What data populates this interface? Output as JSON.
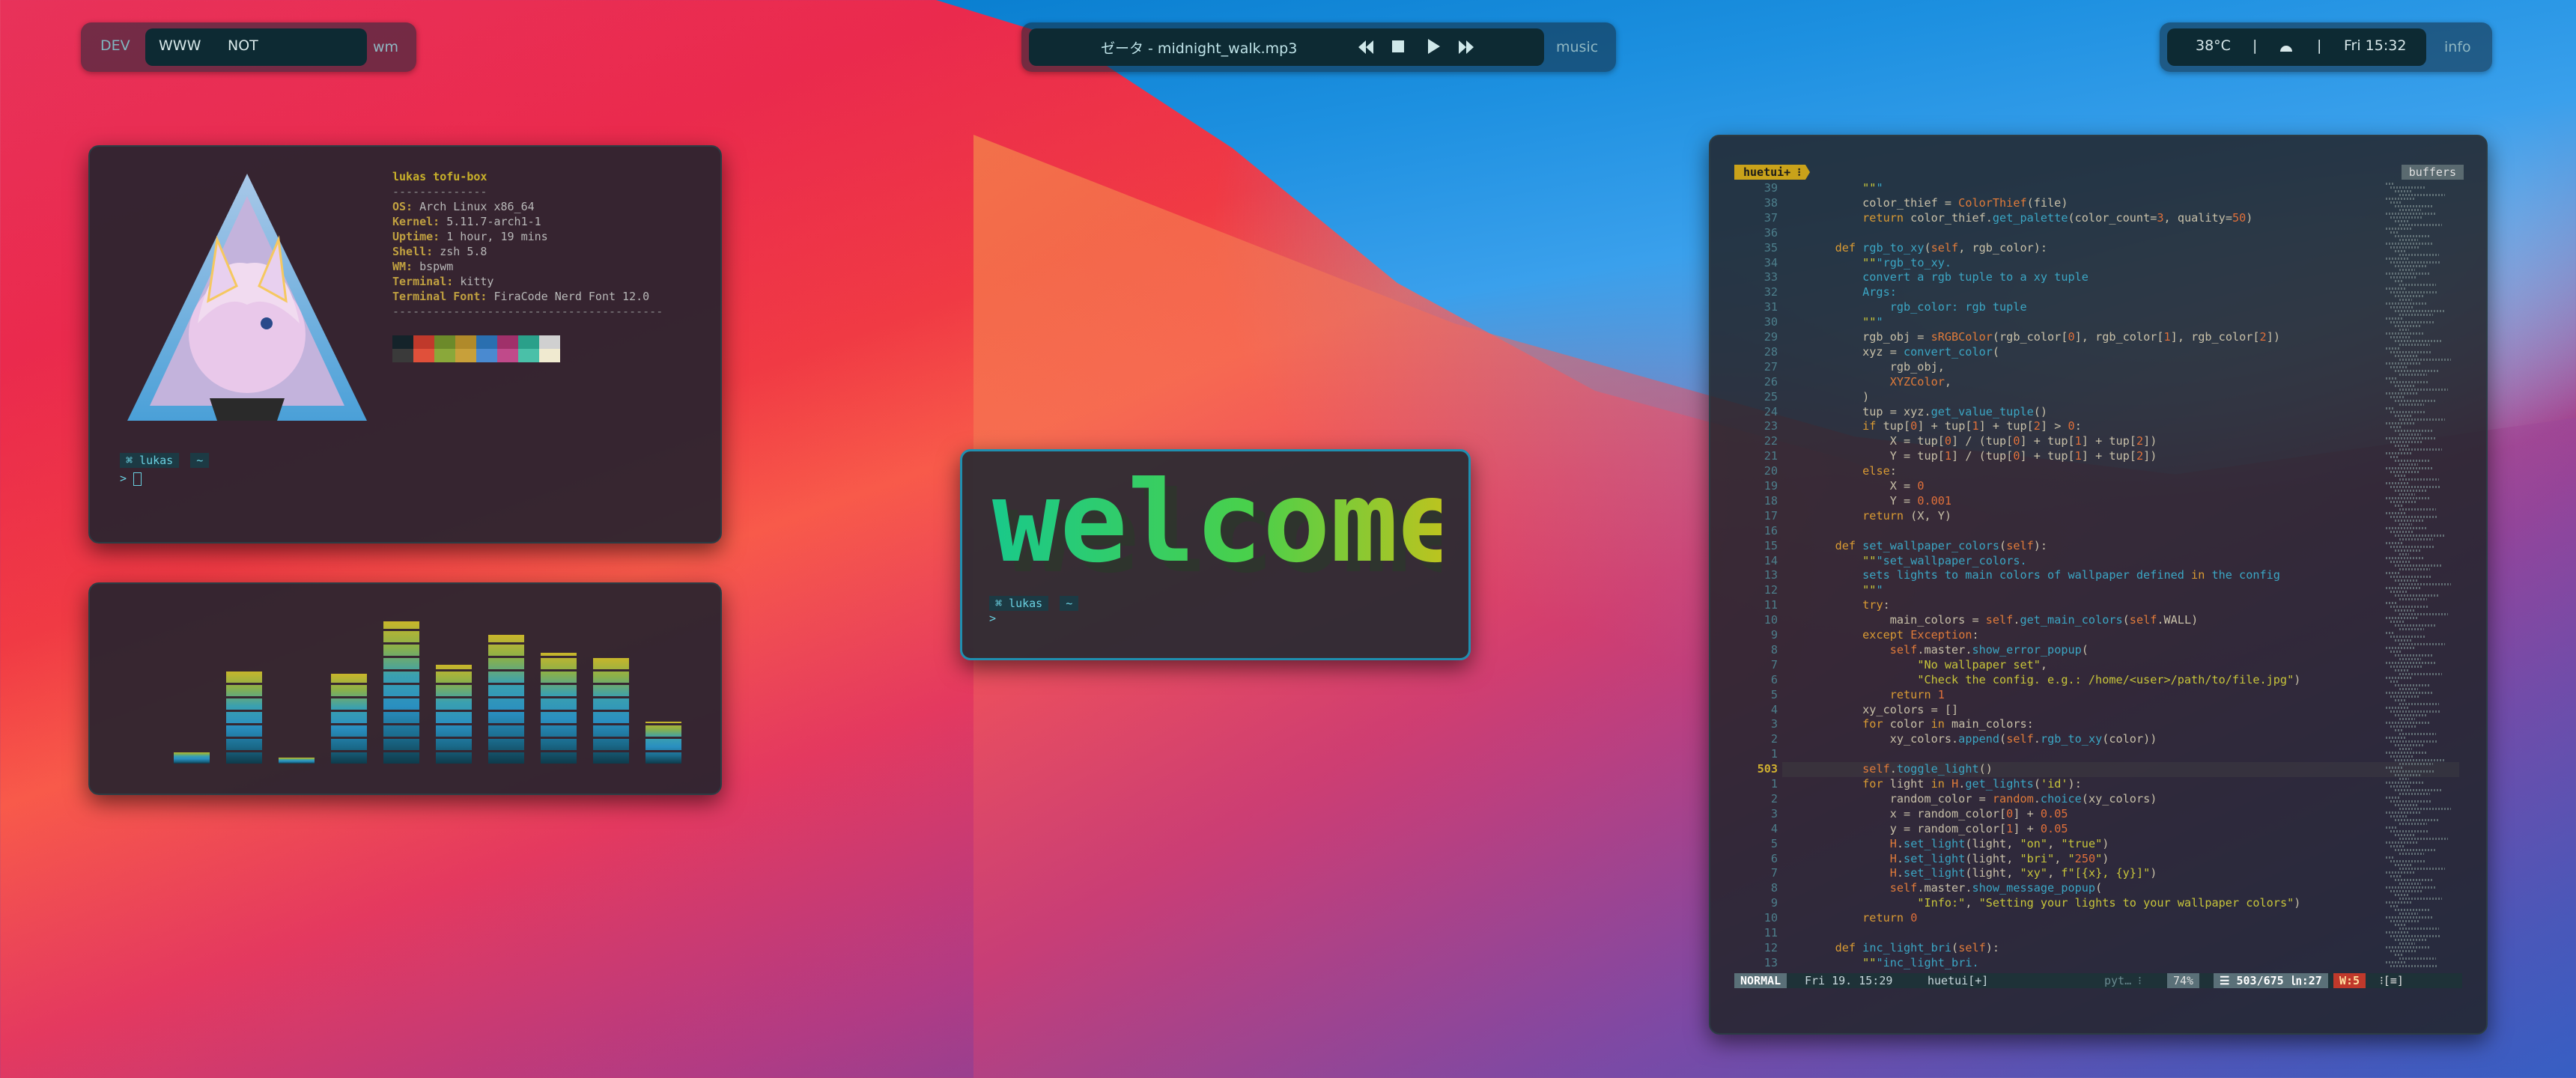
{
  "colors": {
    "accent": "#1f8fb0",
    "yellow": "#c0a040",
    "green": "#21c58a"
  },
  "topbar": {
    "left": {
      "workspaces": [
        "DEV",
        "WWW",
        "NOT"
      ],
      "tag": "wm"
    },
    "center": {
      "track": "ゼータ - midnight_walk.mp3",
      "tag": "music",
      "controls": [
        "prev-icon",
        "stop-icon",
        "play-icon",
        "next-icon"
      ]
    },
    "right": {
      "temp": "38°C",
      "sep": "|",
      "weather_icon": "cloud-icon",
      "time": "Fri 15:32",
      "tag": "info"
    }
  },
  "neofetch": {
    "title": "lukas tofu-box",
    "rule": "--------------",
    "rows": [
      {
        "key": "OS:",
        "val": "Arch Linux x86_64"
      },
      {
        "key": "Kernel:",
        "val": "5.11.7-arch1-1"
      },
      {
        "key": "Uptime:",
        "val": "1 hour, 19 mins"
      },
      {
        "key": "Shell:",
        "val": "zsh 5.8"
      },
      {
        "key": "WM:",
        "val": "bspwm"
      },
      {
        "key": "Terminal:",
        "val": "kitty"
      },
      {
        "key": "Terminal Font:",
        "val": "FiraCode Nerd Font 12.0"
      }
    ],
    "rule2": "----------------------------------------",
    "palette_top": [
      "#14232a",
      "#c0392b",
      "#6c8a2a",
      "#b08a2a",
      "#2a6fb0",
      "#a0306a",
      "#2aa08a",
      "#d0d0d0"
    ],
    "palette_bot": [
      "#3a3a3a",
      "#e0503a",
      "#8aa83a",
      "#c8a03a",
      "#4a8ad0",
      "#c04a8a",
      "#4ac0a8",
      "#f0ead0"
    ],
    "prompt_user": "⌘ lukas",
    "prompt_dir": "~",
    "prompt_caret": ">"
  },
  "visualizer": {
    "levels": [
      0.08,
      0.62,
      0.04,
      0.6,
      0.95,
      0.66,
      0.86,
      0.74,
      0.71,
      0.28
    ]
  },
  "welcome": {
    "text": "welcome",
    "prompt_user": "⌘ lukas",
    "prompt_dir": "~",
    "prompt_caret": ">"
  },
  "editor": {
    "tab": "huetui+ ⁝",
    "buffers": "buffers",
    "status": {
      "mode": "NORMAL",
      "date": "Fri 19. 15:29",
      "file": "huetui[+]",
      "ft": "pyt… ⁝",
      "pct": "74%",
      "pos": "☰ 503/675 ㏑:27",
      "warn": "W:5",
      "extra": "⁝[≡]"
    },
    "current_line": "503",
    "line_numbers": [
      "39",
      "38",
      "37",
      "36",
      "35",
      "34",
      "33",
      "32",
      "31",
      "30",
      "29",
      "28",
      "27",
      "26",
      "25",
      "24",
      "23",
      "22",
      "21",
      "20",
      "19",
      "18",
      "17",
      "16",
      "15",
      "14",
      "13",
      "12",
      "11",
      "10",
      "9",
      "8",
      "7",
      "6",
      "5",
      "4",
      "3",
      "2",
      "1",
      "503",
      "1",
      "2",
      "3",
      "4",
      "5",
      "6",
      "7",
      "8",
      "9",
      "10",
      "11",
      "12",
      "13"
    ],
    "lines": [
      "        \"\"\"",
      "        color_thief = ColorThief(file)",
      "        return color_thief.get_palette(color_count=3, quality=50)",
      "",
      "    def rgb_to_xy(self, rgb_color):",
      "        \"\"\"rgb_to_xy.",
      "        convert a rgb tuple to a xy tuple",
      "        Args:",
      "            rgb_color: rgb tuple",
      "        \"\"\"",
      "        rgb_obj = sRGBColor(rgb_color[0], rgb_color[1], rgb_color[2])",
      "        xyz = convert_color(",
      "            rgb_obj,",
      "            XYZColor,",
      "        )",
      "        tup = xyz.get_value_tuple()",
      "        if tup[0] + tup[1] + tup[2] > 0:",
      "            X = tup[0] / (tup[0] + tup[1] + tup[2])",
      "            Y = tup[1] / (tup[0] + tup[1] + tup[2])",
      "        else:",
      "            X = 0",
      "            Y = 0.001",
      "        return (X, Y)",
      "",
      "    def set_wallpaper_colors(self):",
      "        \"\"\"set_wallpaper_colors.",
      "        sets lights to main colors of wallpaper defined in the config",
      "        \"\"\"",
      "        try:",
      "            main_colors = self.get_main_colors(self.WALL)",
      "        except Exception:",
      "            self.master.show_error_popup(",
      "                \"No wallpaper set\",",
      "                \"Check the config. e.g.: /home/<user>/path/to/file.jpg\")",
      "            return 1",
      "        xy_colors = []",
      "        for color in main_colors:",
      "            xy_colors.append(self.rgb_to_xy(color))",
      "",
      "        self.toggle_light()",
      "        for light in H.get_lights('id'):",
      "            random_color = random.choice(xy_colors)",
      "            x = random_color[0] + 0.05",
      "            y = random_color[1] + 0.05",
      "            H.set_light(light, \"on\", \"true\")",
      "            H.set_light(light, \"bri\", \"250\")",
      "            H.set_light(light, \"xy\", f\"[{x}, {y}]\")",
      "            self.master.show_message_popup(",
      "                \"Info:\", \"Setting your lights to your wallpaper colors\")",
      "        return 0",
      "",
      "    def inc_light_bri(self):",
      "        \"\"\"inc_light_bri."
    ]
  }
}
